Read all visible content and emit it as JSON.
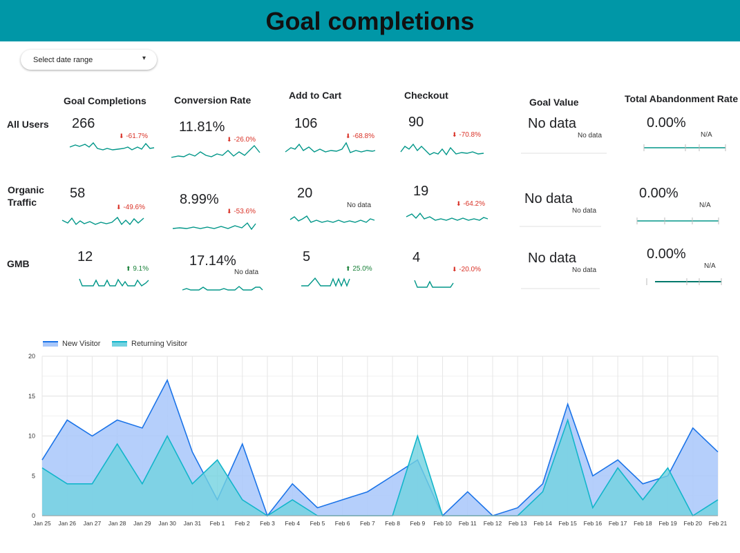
{
  "header": {
    "title": "Goal completions"
  },
  "date_range": {
    "label": "Select date range",
    "caret": "▾"
  },
  "columns": [
    "Goal Completions",
    "Conversion Rate",
    "Add to Cart",
    "Checkout",
    "Goal Value",
    "Total Abandonment Rate"
  ],
  "rows": [
    "All Users",
    "Organic Traffic",
    "GMB"
  ],
  "scorecards": {
    "all_users": [
      {
        "value": "266",
        "delta": "-61.7%",
        "dir": "neg"
      },
      {
        "value": "11.81%",
        "delta": "-26.0%",
        "dir": "neg"
      },
      {
        "value": "106",
        "delta": "-68.8%",
        "dir": "neg"
      },
      {
        "value": "90",
        "delta": "-70.8%",
        "dir": "neg"
      },
      {
        "value": "No data",
        "delta": "No data",
        "dir": "na"
      },
      {
        "value": "0.00%",
        "delta": "N/A",
        "dir": "na"
      }
    ],
    "organic": [
      {
        "value": "58",
        "delta": "-49.6%",
        "dir": "neg"
      },
      {
        "value": "8.99%",
        "delta": "-53.6%",
        "dir": "neg"
      },
      {
        "value": "20",
        "delta": "No data",
        "dir": "na"
      },
      {
        "value": "19",
        "delta": "-64.2%",
        "dir": "neg"
      },
      {
        "value": "No data",
        "delta": "No data",
        "dir": "na"
      },
      {
        "value": "0.00%",
        "delta": "N/A",
        "dir": "na"
      }
    ],
    "gmb": [
      {
        "value": "12",
        "delta": "9.1%",
        "dir": "pos"
      },
      {
        "value": "17.14%",
        "delta": "No data",
        "dir": "na"
      },
      {
        "value": "5",
        "delta": "25.0%",
        "dir": "pos"
      },
      {
        "value": "4",
        "delta": "-20.0%",
        "dir": "neg"
      },
      {
        "value": "No data",
        "delta": "No data",
        "dir": "na"
      },
      {
        "value": "0.00%",
        "delta": "N/A",
        "dir": "na"
      }
    ]
  },
  "colors": {
    "header": "#0097a7",
    "spark": "#009688",
    "new_visitor_line": "#1a73e8",
    "new_visitor_fill": "#a8c7fa",
    "returning_visitor_line": "#12b5cb",
    "returning_visitor_fill": "#72d2e0",
    "negative": "#d93025",
    "positive": "#188038"
  },
  "chart_data": {
    "type": "area",
    "x": [
      "Jan 25",
      "Jan 26",
      "Jan 27",
      "Jan 28",
      "Jan 29",
      "Jan 30",
      "Jan 31",
      "Feb 1",
      "Feb 2",
      "Feb 3",
      "Feb 4",
      "Feb 5",
      "Feb 6",
      "Feb 7",
      "Feb 8",
      "Feb 9",
      "Feb 10",
      "Feb 11",
      "Feb 12",
      "Feb 13",
      "Feb 14",
      "Feb 15",
      "Feb 16",
      "Feb 17",
      "Feb 18",
      "Feb 19",
      "Feb 20",
      "Feb 21"
    ],
    "series": [
      {
        "name": "New Visitor",
        "values": [
          7,
          12,
          10,
          12,
          11,
          17,
          8,
          2,
          9,
          0,
          4,
          1,
          2,
          3,
          5,
          7,
          0,
          3,
          0,
          1,
          4,
          14,
          5,
          7,
          4,
          5,
          11,
          8
        ]
      },
      {
        "name": "Returning Visitor",
        "values": [
          6,
          4,
          4,
          9,
          4,
          10,
          4,
          7,
          2,
          0,
          2,
          0,
          0,
          0,
          0,
          10,
          0,
          0,
          0,
          0,
          3,
          12,
          1,
          6,
          2,
          6,
          0,
          2
        ]
      }
    ],
    "ylim": [
      0,
      20
    ],
    "yticks": [
      0,
      5,
      10,
      15,
      20
    ],
    "grid": true,
    "legend": "top-left",
    "xlabel": "",
    "ylabel": ""
  }
}
